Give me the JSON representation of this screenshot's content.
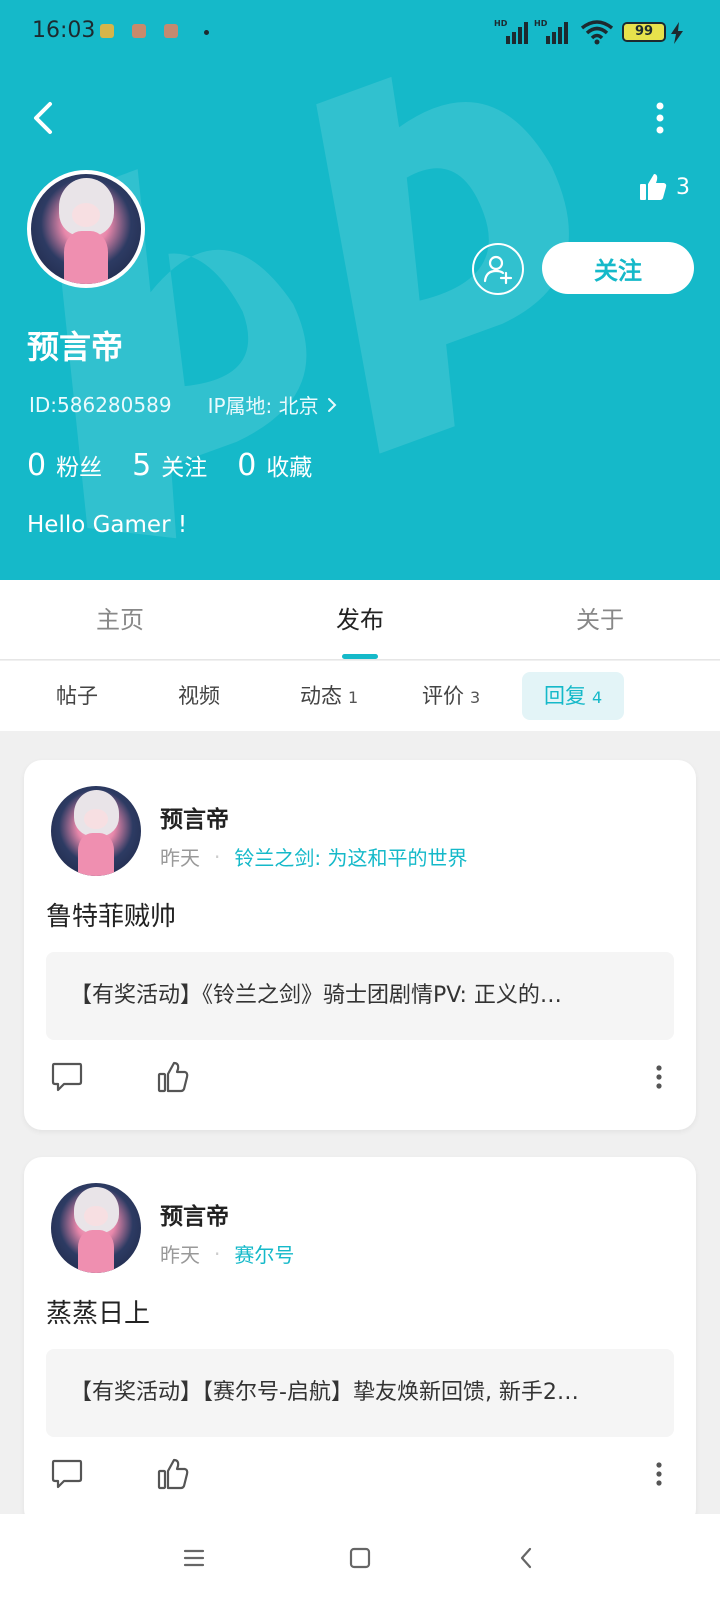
{
  "status_bar": {
    "time": "16:03",
    "network_labels": [
      "HD",
      "HD"
    ],
    "battery_level": "99",
    "battery_fraction": 0.99
  },
  "header": {
    "back_icon": "back-chevron-icon",
    "more_icon": "more-vertical-icon",
    "likes_count": "3",
    "follow_label": "关注",
    "username": "预言帝",
    "id_text": "ID:586280589",
    "ip_text": "IP属地: 北京",
    "stats": [
      {
        "num": "0",
        "label": "粉丝"
      },
      {
        "num": "5",
        "label": "关注"
      },
      {
        "num": "0",
        "label": "收藏"
      }
    ],
    "bio": "Hello Gamer !",
    "accent_color": "#15b9c9"
  },
  "tabs": [
    {
      "label": "主页"
    },
    {
      "label": "发布"
    },
    {
      "label": "关于"
    }
  ],
  "active_tab": "发布",
  "subtabs": [
    {
      "label": "帖子",
      "count": ""
    },
    {
      "label": "视频",
      "count": ""
    },
    {
      "label": "动态",
      "count": "1"
    },
    {
      "label": "评价",
      "count": "3"
    },
    {
      "label": "回复",
      "count": "4"
    }
  ],
  "active_subtab": "回复",
  "posts": [
    {
      "author": "预言帝",
      "time": "昨天",
      "game": "铃兰之剑: 为这和平的世界",
      "content": "鲁特菲贼帅",
      "quote": "【有奖活动】《铃兰之剑》骑士团剧情PV: 正义的…"
    },
    {
      "author": "预言帝",
      "time": "昨天",
      "game": "赛尔号",
      "content": "蒸蒸日上",
      "quote": "【有奖活动】【赛尔号-启航】挚友焕新回馈, 新手2…"
    }
  ]
}
